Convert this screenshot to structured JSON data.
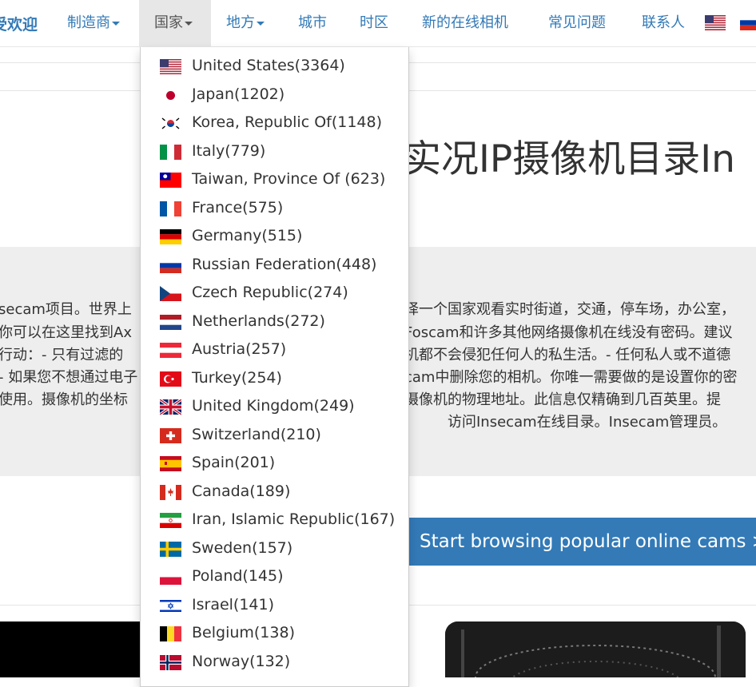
{
  "nav": {
    "brand": "受欢迎",
    "manufacturer": "制造商",
    "country": "国家",
    "places": "地方",
    "city": "城市",
    "timezone": "时区",
    "new_online": "新的在线相机",
    "faq": "常见问题",
    "contacts": "联系人"
  },
  "headline": "实况IP摄像机目录In",
  "info_lines": [
    "secam项目。世界上",
    "你可以在这里找到Ax",
    "行动：- 只有过滤的",
    "- 如果您不想通过电子",
    "使用。摄像机的坐标",
    "译一个国家观看实时街道，交通，停车场，办公室，",
    "Foscam和许多其他网络摄像机在线没有密码。建议",
    "机都不会侵犯任何人的私生活。- 任何私人或不道德",
    "cam中删除您的相机。你唯一需要做的是设置你的密",
    "摄像机的物理地址。此信息仅精确到几百英里。提",
    "访问Insecam在线目录。Insecam管理员。"
  ],
  "cta_label": "Start browsing popular online cams >>",
  "countries": [
    {
      "label": "United States(3364)",
      "flag": "us"
    },
    {
      "label": "Japan(1202)",
      "flag": "jp"
    },
    {
      "label": "Korea, Republic Of(1148)",
      "flag": "kr"
    },
    {
      "label": "Italy(779)",
      "flag": "it"
    },
    {
      "label": "Taiwan, Province Of (623)",
      "flag": "tw"
    },
    {
      "label": "France(575)",
      "flag": "fr"
    },
    {
      "label": "Germany(515)",
      "flag": "de"
    },
    {
      "label": "Russian Federation(448)",
      "flag": "ru"
    },
    {
      "label": "Czech Republic(274)",
      "flag": "cz"
    },
    {
      "label": "Netherlands(272)",
      "flag": "nl"
    },
    {
      "label": "Austria(257)",
      "flag": "at"
    },
    {
      "label": "Turkey(254)",
      "flag": "tr"
    },
    {
      "label": "United Kingdom(249)",
      "flag": "gb"
    },
    {
      "label": "Switzerland(210)",
      "flag": "ch"
    },
    {
      "label": "Spain(201)",
      "flag": "es"
    },
    {
      "label": "Canada(189)",
      "flag": "ca"
    },
    {
      "label": "Iran, Islamic Republic(167)",
      "flag": "ir"
    },
    {
      "label": "Sweden(157)",
      "flag": "se"
    },
    {
      "label": "Poland(145)",
      "flag": "pl"
    },
    {
      "label": "Israel(141)",
      "flag": "il"
    },
    {
      "label": "Belgium(138)",
      "flag": "be"
    },
    {
      "label": "Norway(132)",
      "flag": "no"
    }
  ],
  "colors": {
    "link": "#337ab7",
    "cta_bg": "#337ab7",
    "info_bg": "#eeeeee"
  }
}
